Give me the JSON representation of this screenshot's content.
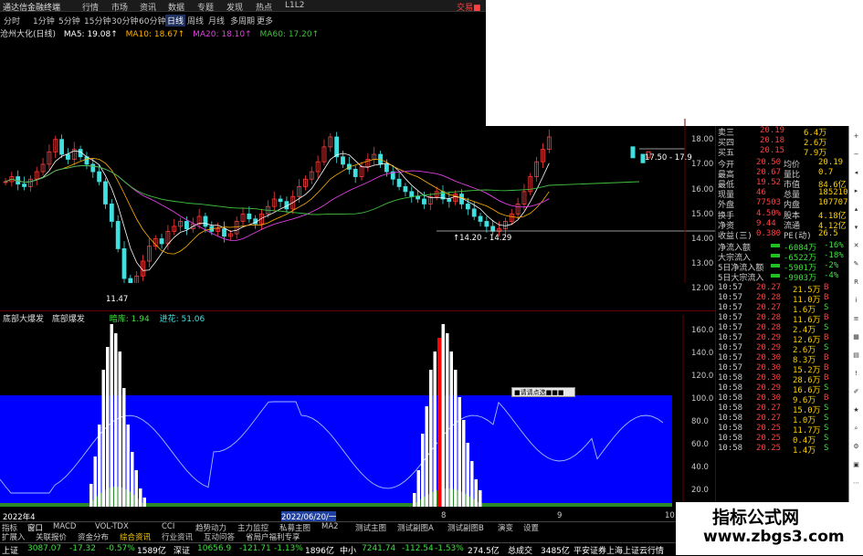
{
  "window": {
    "title": "通达信金融终端",
    "menu": [
      "行情",
      "市场",
      "资讯",
      "数据",
      "专题",
      "发现",
      "热点",
      "L1L2"
    ],
    "trade_btn": "交易■"
  },
  "periods": [
    "分时",
    "1分钟",
    "5分钟",
    "15分钟",
    "30分钟",
    "60分钟",
    "日线",
    "周线",
    "月线",
    "多周期",
    "更多"
  ],
  "selected_period": "日线",
  "ma": {
    "name": "沧州大化(日线)",
    "ma5": "MA5: 19.08↑",
    "ma10": "MA10: 18.67↑",
    "ma20": "MA20: 18.10↑",
    "ma60": "MA60: 17.20↑"
  },
  "price_axis": [
    "18.00",
    "17.00",
    "16.00",
    "15.00",
    "14.00",
    "13.00",
    "12.00"
  ],
  "annotations": {
    "low": "11.47",
    "range_low": "↑14.20 - 14.29",
    "range_high": "17.50 - 17.9"
  },
  "indicator": {
    "name": "底部大爆发",
    "label2": "底部爆发",
    "l1": "暗库: 1.94",
    "l2": "进花: 51.06"
  },
  "ind_axis": [
    "160.0",
    "140.0",
    "120.0",
    "100.0",
    "80.0",
    "60.0",
    "40.0",
    "20.0"
  ],
  "popup": "■请请点选■■■",
  "date_labels": {
    "d1": "2022年4",
    "d2": "2022/06/20/一",
    "d3": "8",
    "d4": "9",
    "d5": "10"
  },
  "quote_top": [
    {
      "k": "卖三",
      "v": "20.19",
      "q": "6.4万"
    },
    {
      "k": "买四",
      "v": "20.18",
      "q": "2.6万"
    },
    {
      "k": "买五",
      "v": "20.15",
      "q": "7.9万"
    }
  ],
  "quote": [
    {
      "k": "今开",
      "v": "20.50",
      "k2": "均价",
      "v2": "20.19"
    },
    {
      "k": "最高",
      "v": "20.67",
      "k2": "量比",
      "v2": "0.7"
    },
    {
      "k": "最低",
      "v": "19.52",
      "k2": "市值",
      "v2": "84.6亿"
    },
    {
      "k": "现量",
      "v": "46",
      "k2": "总量",
      "v2": "185210"
    },
    {
      "k": "外盘",
      "v": "77503",
      "k2": "内盘",
      "v2": "107707"
    },
    {
      "k": "换手",
      "v": "4.50%",
      "k2": "股本",
      "v2": "4.18亿"
    },
    {
      "k": "净资",
      "v": "9.44",
      "k2": "流通",
      "v2": "4.12亿"
    },
    {
      "k": "收益(三)",
      "v": "0.380",
      "k2": "PE(动)",
      "v2": "26.5"
    }
  ],
  "flows": [
    {
      "k": "净流入额",
      "v": "-6084万",
      "p": "-16%"
    },
    {
      "k": "大宗流入",
      "v": "-6522万",
      "p": "-18%"
    },
    {
      "k": "5日净流入额",
      "v": "-5901万",
      "p": "-2%"
    },
    {
      "k": "5日大宗流入",
      "v": "-9903万",
      "p": "-4%"
    }
  ],
  "ticks": [
    [
      "10:57",
      "20.27",
      "21.5万",
      "B"
    ],
    [
      "10:57",
      "20.28",
      "11.0万",
      "B"
    ],
    [
      "10:57",
      "20.27",
      "1.6万",
      "S"
    ],
    [
      "10:57",
      "20.28",
      "11.6万",
      "B"
    ],
    [
      "10:57",
      "20.28",
      "2.4万",
      "S"
    ],
    [
      "10:57",
      "20.29",
      "12.6万",
      "B"
    ],
    [
      "10:57",
      "20.29",
      "2.6万",
      "S"
    ],
    [
      "10:57",
      "20.30",
      "8.3万",
      "B"
    ],
    [
      "10:57",
      "20.30",
      "15.2万",
      "B"
    ],
    [
      "10:58",
      "20.30",
      "28.6万",
      "B"
    ],
    [
      "10:58",
      "20.29",
      "16.6万",
      "S"
    ],
    [
      "10:58",
      "20.30",
      "9.6万",
      "B"
    ],
    [
      "10:58",
      "20.27",
      "15.0万",
      "S"
    ],
    [
      "10:58",
      "20.27",
      "1.0万",
      "S"
    ],
    [
      "10:58",
      "20.25",
      "11.7万",
      "S"
    ],
    [
      "10:58",
      "20.25",
      "0.4万",
      "S"
    ],
    [
      "10:58",
      "20.25",
      "1.4万",
      "S"
    ]
  ],
  "bottom_tabs": [
    "指标",
    "窗口",
    "MACD",
    "VOL-TDX",
    "CCI",
    "趋势动力",
    "主力监控",
    "私募主图",
    "MA2",
    "测试主图",
    "测试副图A",
    "测试副图B",
    "演变",
    "设置"
  ],
  "bottom_tabs2": [
    "扩展入",
    "关联报价",
    "资金分布",
    "综合资讯",
    "行业资讯",
    "互动问答",
    "省局户福利专享"
  ],
  "statusbar": {
    "sh": "上证",
    "sh_v": "3087.07",
    "sh_c": "-17.32",
    "sh_p": "-0.57%",
    "sh_a": "1589亿",
    "sz": "深证",
    "sz_v": "10656.9",
    "sz_c": "-121.71",
    "sz_p": "-1.13%",
    "sz_a": "1896亿",
    "zx": "中小",
    "zx_v": "7241.74",
    "zx_c": "-112.54",
    "zx_p": "-1.53%",
    "zx_a": "274.5亿",
    "tot": "总成交",
    "tot_a": "3485亿",
    "broker": "平安证券上海上证云行情"
  },
  "watermark": {
    "line1": "指标公式网",
    "line2": "www.zbgs3.com"
  },
  "colors": {
    "up": "#ff3b3b",
    "down": "#40e0e0",
    "blue": "#0000ff",
    "ma5": "#ffffff",
    "ma10": "#ffb000",
    "ma20": "#e040e0",
    "ma60": "#40c040"
  }
}
